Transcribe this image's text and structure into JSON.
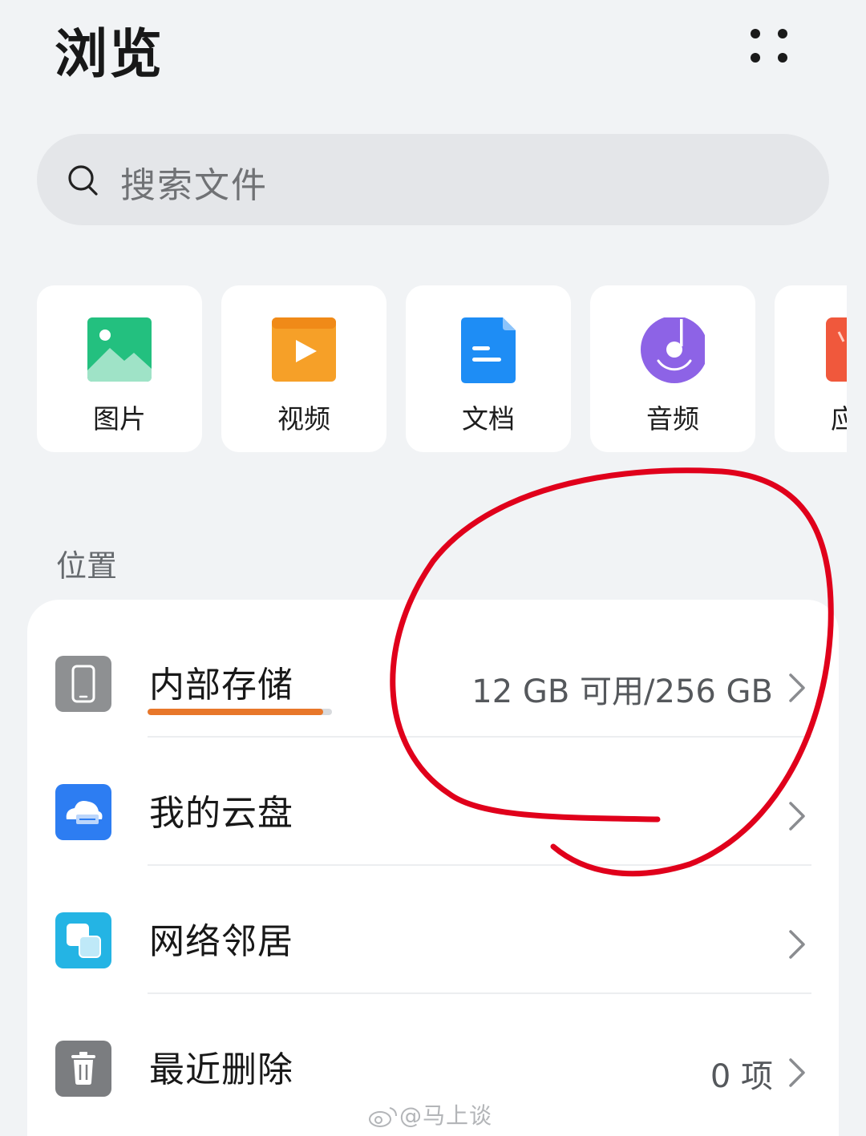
{
  "header": {
    "title": "浏览"
  },
  "search": {
    "placeholder": "搜索文件"
  },
  "categories": [
    {
      "label": "图片",
      "icon": "image-icon",
      "color": "#2cc58b"
    },
    {
      "label": "视频",
      "icon": "video-icon",
      "color": "#f6a028"
    },
    {
      "label": "文档",
      "icon": "document-icon",
      "color": "#1e8df5"
    },
    {
      "label": "音频",
      "icon": "audio-icon",
      "color": "#8d63e6"
    },
    {
      "label": "应",
      "icon": "app-icon",
      "color": "#f0583c"
    }
  ],
  "locations": {
    "title": "位置",
    "items": [
      {
        "label": "内部存储",
        "value": "12 GB 可用/256 GB",
        "icon": "phone-icon",
        "used_fraction": 0.953
      },
      {
        "label": "我的云盘",
        "value": "",
        "icon": "cloud-drive-icon"
      },
      {
        "label": "网络邻居",
        "value": "",
        "icon": "network-neighbor-icon"
      },
      {
        "label": "最近删除",
        "value": "0 项",
        "icon": "trash-icon"
      }
    ]
  },
  "watermark": {
    "text": "@马上谈"
  },
  "colors": {
    "accent_orange": "#e8772a",
    "annotation_red": "#e0001b"
  }
}
